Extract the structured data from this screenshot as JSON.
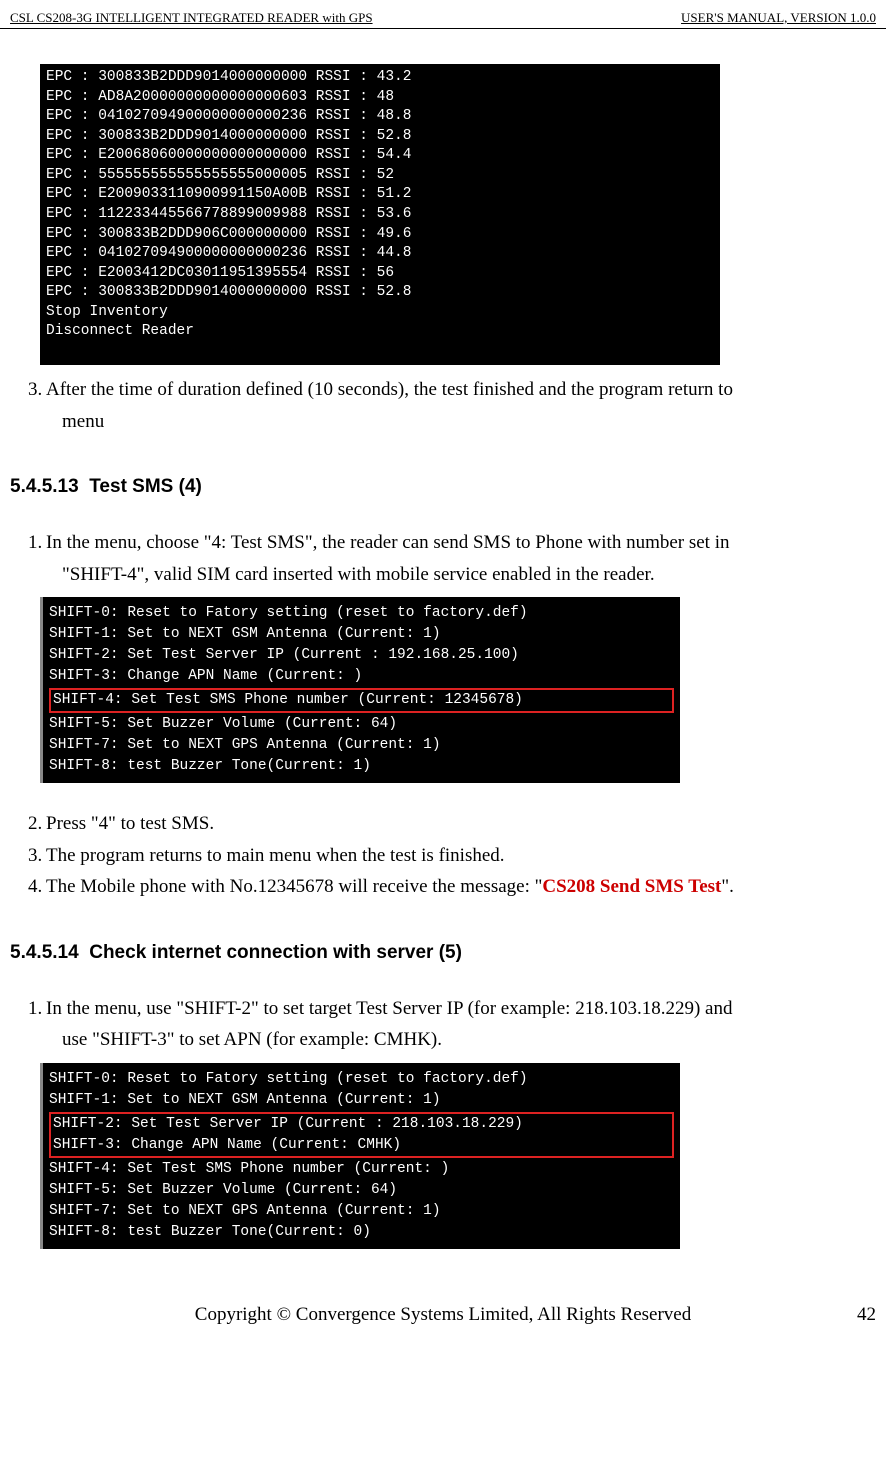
{
  "header": {
    "left": "CSL CS208-3G INTELLIGENT INTEGRATED READER with GPS",
    "right": "USER'S  MANUAL,  VERSION  1.0.0"
  },
  "terminal1_lines": [
    "EPC : 300833B2DDD9014000000000 RSSI : 43.2",
    "EPC : AD8A20000000000000000603 RSSI : 48",
    "EPC : 041027094900000000000236 RSSI : 48.8",
    "EPC : 300833B2DDD9014000000000 RSSI : 52.8",
    "EPC : E20068060000000000000000 RSSI : 54.4",
    "EPC : 555555555555555555000005 RSSI : 52",
    "EPC : E2009033110900991150A00B RSSI : 51.2",
    "EPC : 112233445566778899009988 RSSI : 53.6",
    "EPC : 300833B2DDD906C000000000 RSSI : 49.6",
    "EPC : 041027094900000000000236 RSSI : 44.8",
    "EPC : E2003412DC03011951395554 RSSI : 56",
    "EPC : 300833B2DDD9014000000000 RSSI : 52.8",
    "Stop Inventory",
    "Disconnect Reader",
    "",
    ""
  ],
  "para_after_term1_a": "After the time of duration defined (10 seconds), the test finished and the program return to",
  "para_after_term1_b": "menu",
  "heading_sms_no": "5.4.5.13",
  "heading_sms_title": "Test SMS (4)",
  "sms_para_a": "In the menu, choose \"4: Test SMS\", the reader can send SMS to Phone with number set in",
  "sms_para_b": "\"SHIFT-4\", valid SIM card inserted with mobile service enabled in the reader.",
  "terminal2_pre": [
    "SHIFT-0: Reset to Fatory setting (reset to factory.def)",
    "SHIFT-1: Set to NEXT GSM Antenna (Current: 1)",
    "SHIFT-2: Set Test Server IP (Current : 192.168.25.100)",
    "SHIFT-3: Change APN Name (Current: )"
  ],
  "terminal2_highlight": "SHIFT-4: Set Test SMS Phone number (Current: 12345678)",
  "terminal2_post": [
    "SHIFT-5: Set Buzzer Volume (Current: 64)",
    "SHIFT-7: Set to NEXT GPS Antenna (Current: 1)",
    "SHIFT-8: test Buzzer Tone(Current: 1)",
    ""
  ],
  "step2": "Press \"4\" to test SMS.",
  "step3": "The program returns to main menu when the test is finished.",
  "step4_a": "The Mobile phone with No.12345678 will receive the message: \"",
  "step4_red": "CS208 Send SMS Test",
  "step4_b": "\".",
  "heading_net_no": "5.4.5.14",
  "heading_net_title": "Check internet connection with server (5)",
  "net_para_a": "In the menu, use \"SHIFT-2\" to set target Test Server IP (for example: 218.103.18.229) and",
  "net_para_b": "use \"SHIFT-3\" to set APN (for example: CMHK).",
  "terminal3_pre": [
    "SHIFT-0: Reset to Fatory setting (reset to factory.def)",
    "SHIFT-1: Set to NEXT GSM Antenna (Current: 1)"
  ],
  "terminal3_highlight": [
    "SHIFT-2: Set Test Server IP (Current : 218.103.18.229)",
    "SHIFT-3: Change APN Name (Current: CMHK)"
  ],
  "terminal3_post": [
    "SHIFT-4: Set Test SMS Phone number (Current: )",
    "SHIFT-5: Set Buzzer Volume (Current: 64)",
    "SHIFT-7: Set to NEXT GPS Antenna (Current: 1)",
    "SHIFT-8: test Buzzer Tone(Current: 0)",
    ""
  ],
  "footer": {
    "copyright": "Copyright © Convergence Systems Limited, All Rights Reserved",
    "page": "42"
  }
}
